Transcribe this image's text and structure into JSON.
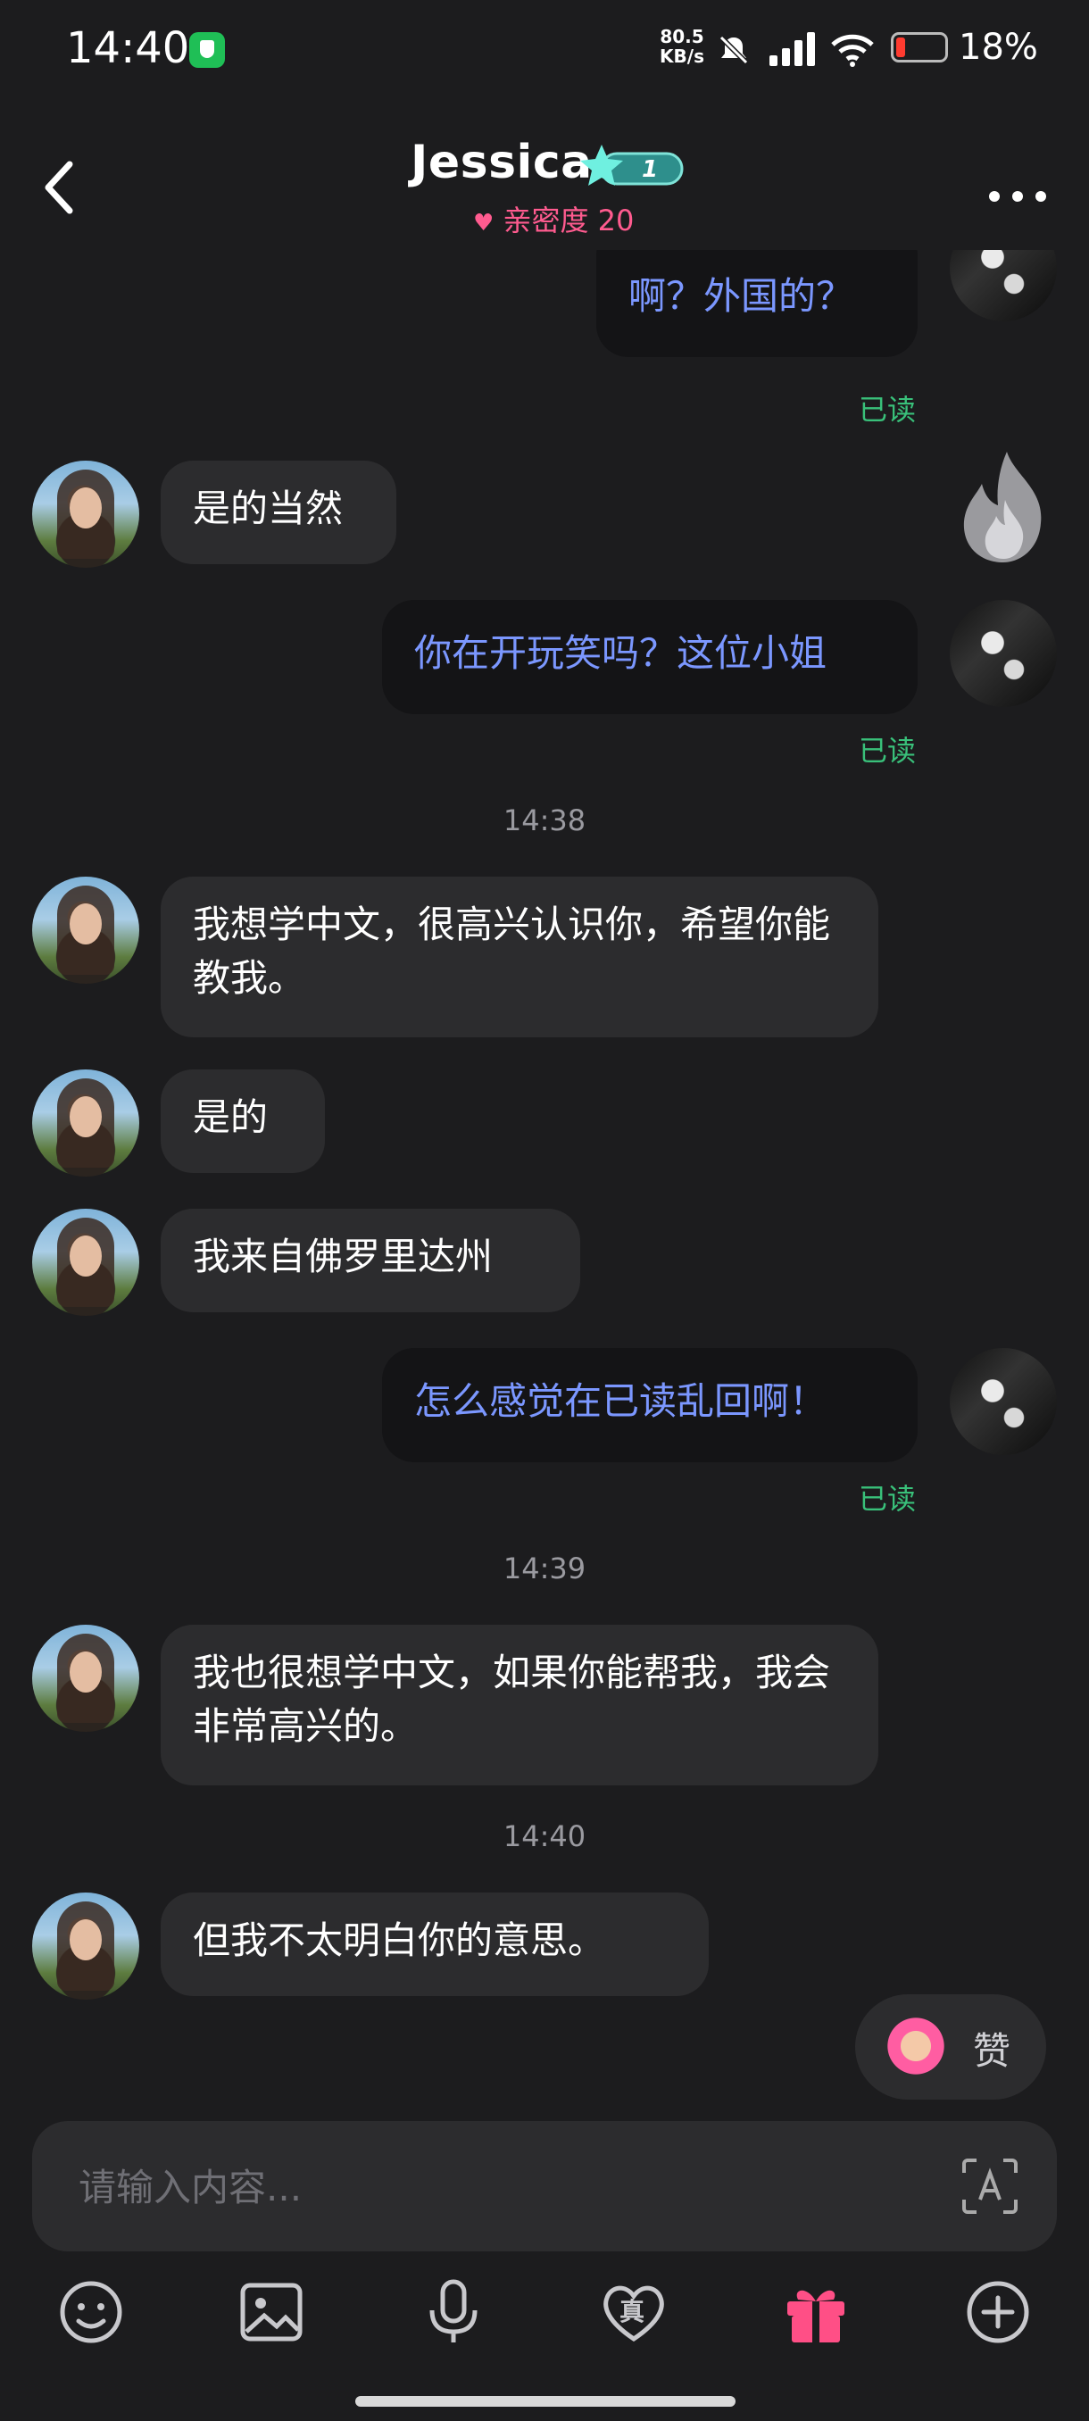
{
  "status_bar": {
    "time": "14:40",
    "net_speed_value": "80.5",
    "net_speed_unit": "KB/s",
    "battery": "18%"
  },
  "header": {
    "title": "Jessica",
    "level": "1",
    "intimacy": "亲密度 20",
    "back_icon": "chevron-left-icon",
    "more_icon": "more-dots-icon"
  },
  "messages": {
    "m1": {
      "text": "啊？外国的？",
      "status": "已读"
    },
    "m2": {
      "text": "是的当然"
    },
    "m3": {
      "text": "你在开玩笑吗？这位小姐",
      "status": "已读"
    },
    "t1": "14:38",
    "m4": {
      "text": "我想学中文，很高兴认识你，希望你能教我。"
    },
    "m5": {
      "text": "是的"
    },
    "m6": {
      "text": "我来自佛罗里达州"
    },
    "m7": {
      "text": "怎么感觉在已读乱回啊！",
      "status": "已读"
    },
    "t2": "14:39",
    "m8": {
      "text": "我也很想学中文，如果你能帮我，我会非常高兴的。"
    },
    "t3": "14:40",
    "m9": {
      "text": "但我不太明白你的意思。"
    }
  },
  "like": {
    "label": "赞"
  },
  "composer": {
    "placeholder": "请输入内容..."
  },
  "toolbar": {
    "truth_label": "真"
  },
  "colors": {
    "accent_pink": "#ff5b8f",
    "read_green": "#39c07a",
    "outgoing_text": "#7b97ff"
  }
}
